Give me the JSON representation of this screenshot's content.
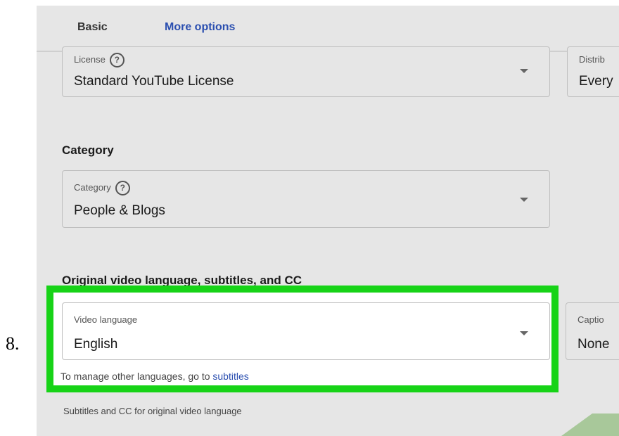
{
  "step_number": "8.",
  "tabs": {
    "basic": "Basic",
    "more_options": "More options"
  },
  "license": {
    "label": "License",
    "help": "?",
    "value": "Standard YouTube License"
  },
  "distribution": {
    "label": "Distrib",
    "value": "Every"
  },
  "category_section": {
    "title": "Category"
  },
  "category": {
    "label": "Category",
    "help": "?",
    "value": "People & Blogs"
  },
  "language_section": {
    "title": "Original video language, subtitles, and CC"
  },
  "video_language": {
    "label": "Video language",
    "value": "English"
  },
  "captions": {
    "label": "Captio",
    "value": "None"
  },
  "manage_text": "To manage other languages, go to ",
  "manage_link": "subtitles",
  "subtitles_note": "Subtitles and CC for original video language",
  "colors": {
    "highlight": "#17d317",
    "accent": "#2b4fb0"
  }
}
